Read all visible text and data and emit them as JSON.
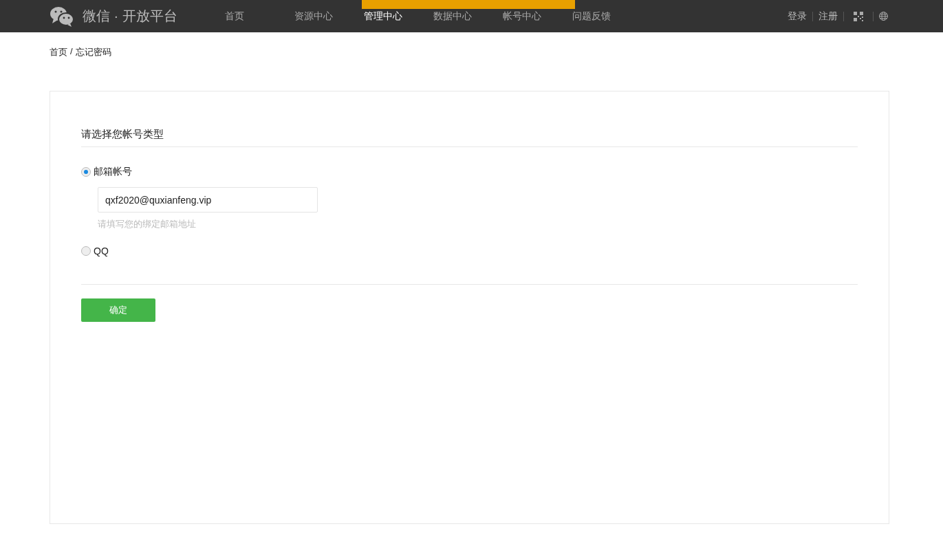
{
  "header": {
    "brand": "微信 · 开放平台",
    "nav": [
      {
        "label": "首页",
        "selected": false
      },
      {
        "label": "资源中心",
        "selected": false
      },
      {
        "label": "管理中心",
        "selected": true
      },
      {
        "label": "数据中心",
        "selected": false
      },
      {
        "label": "帐号中心",
        "selected": false
      },
      {
        "label": "问题反馈",
        "selected": false
      }
    ],
    "links": [
      "登录",
      "注册"
    ]
  },
  "toast": {
    "kind": "warning"
  },
  "breadcrumb": {
    "separator": "/",
    "items": [
      "首页",
      "忘记密码"
    ]
  },
  "form": {
    "title": "请选择您帐号类型",
    "options": [
      {
        "label": "邮箱帐号",
        "selected": true,
        "value": "qxf2020@quxianfeng.vip",
        "hint": "请填写您的绑定邮箱地址"
      },
      {
        "label": "QQ",
        "selected": false
      }
    ],
    "submit": "确定"
  }
}
